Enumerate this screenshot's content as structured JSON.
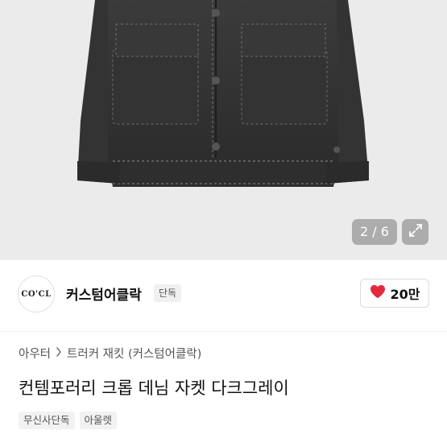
{
  "gallery": {
    "counter": "2 / 6",
    "expand_icon": "expand-arrows-icon"
  },
  "brand": {
    "logo_text": "CO'CL",
    "name": "커스텀어클락",
    "badge": "단독"
  },
  "like": {
    "icon": "heart-icon",
    "count": "20만",
    "color": "#e5293c"
  },
  "product": {
    "breadcrumb": [
      "아우터",
      "트러커 재킷 (커스텀어클락)"
    ],
    "title": "컨템포러리 크롭 데님 자켓 다크그레이",
    "tags": [
      "무신사단독",
      "아울렛"
    ]
  }
}
